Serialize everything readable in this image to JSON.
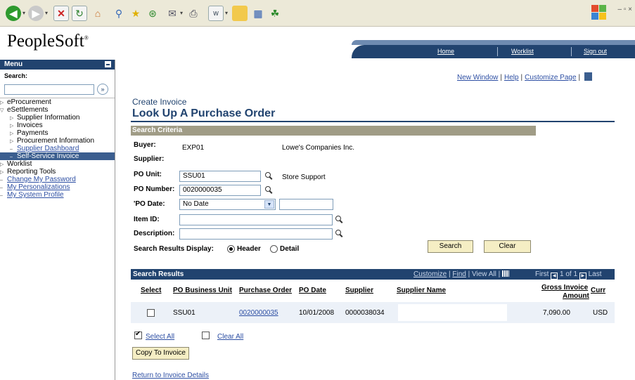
{
  "header": {
    "logo": "PeopleSoft",
    "nav": [
      "Home",
      "Worklist",
      "Sign out"
    ]
  },
  "menu": {
    "title": "Menu",
    "search_label": "Search:",
    "items": [
      {
        "label": "eProcurement",
        "type": "folder"
      },
      {
        "label": "eSettlements",
        "type": "folder-open"
      },
      {
        "label": "Supplier Information",
        "type": "sub-folder"
      },
      {
        "label": "Invoices",
        "type": "sub-folder"
      },
      {
        "label": "Payments",
        "type": "sub-folder"
      },
      {
        "label": "Procurement Information",
        "type": "sub-folder"
      },
      {
        "label": "Supplier Dashboard",
        "type": "sub-link"
      },
      {
        "label": "Self-Service Invoice",
        "type": "sub-selected"
      },
      {
        "label": "Worklist",
        "type": "folder"
      },
      {
        "label": "Reporting Tools",
        "type": "folder"
      },
      {
        "label": "Change My Password",
        "type": "link"
      },
      {
        "label": "My Personalizations",
        "type": "link"
      },
      {
        "label": "My System Profile",
        "type": "link"
      }
    ]
  },
  "top_links": {
    "new_window": "New Window",
    "help": "Help",
    "customize_page": "Customize Page"
  },
  "breadcrumb": "Create Invoice",
  "page_title": "Look Up A Purchase Order",
  "criteria": {
    "section_title": "Search Criteria",
    "buyer_label": "Buyer:",
    "buyer_value": "EXP01",
    "buyer_name": "Lowe's Companies Inc.",
    "supplier_label": "Supplier:",
    "po_unit_label": "PO Unit:",
    "po_unit_value": "SSU01",
    "po_unit_desc": "Store Support",
    "po_number_label": "PO Number:",
    "po_number_value": "0020000035",
    "po_date_label": "'PO Date:",
    "po_date_value": "No Date",
    "item_id_label": "Item ID:",
    "description_label": "Description:",
    "display_label": "Search Results Display:",
    "display_options": [
      "Header",
      "Detail"
    ],
    "display_selected": "Header",
    "search_button": "Search",
    "clear_button": "Clear"
  },
  "results": {
    "title": "Search Results",
    "customize": "Customize",
    "find": "Find",
    "view_all": "View All",
    "nav_first": "First",
    "nav_range": "1 of 1",
    "nav_last": "Last",
    "columns": {
      "select": "Select",
      "po_bu": "PO Business Unit",
      "po": "Purchase Order",
      "po_date": "PO Date",
      "supplier": "Supplier",
      "supplier_name": "Supplier Name",
      "gross_1": "Gross Invoice",
      "gross_2": "Amount",
      "curr": "Curr"
    },
    "rows": [
      {
        "selected": false,
        "po_bu": "SSU01",
        "po": "0020000035",
        "po_date": "10/01/2008",
        "supplier": "0000038034",
        "supplier_name": "",
        "gross": "7,090.00",
        "curr": "USD"
      }
    ],
    "select_all": "Select All",
    "clear_all": "Clear All"
  },
  "copy_button": "Copy To Invoice",
  "return_link": "Return to Invoice Details"
}
